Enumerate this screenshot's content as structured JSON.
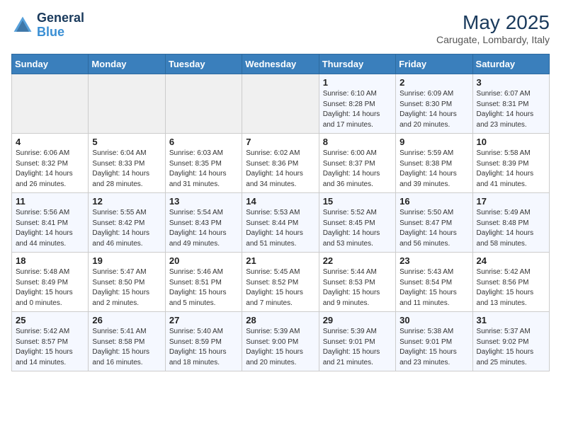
{
  "header": {
    "logo_line1": "General",
    "logo_line2": "Blue",
    "month": "May 2025",
    "location": "Carugate, Lombardy, Italy"
  },
  "weekdays": [
    "Sunday",
    "Monday",
    "Tuesday",
    "Wednesday",
    "Thursday",
    "Friday",
    "Saturday"
  ],
  "weeks": [
    [
      {
        "day": "",
        "info": ""
      },
      {
        "day": "",
        "info": ""
      },
      {
        "day": "",
        "info": ""
      },
      {
        "day": "",
        "info": ""
      },
      {
        "day": "1",
        "info": "Sunrise: 6:10 AM\nSunset: 8:28 PM\nDaylight: 14 hours\nand 17 minutes."
      },
      {
        "day": "2",
        "info": "Sunrise: 6:09 AM\nSunset: 8:30 PM\nDaylight: 14 hours\nand 20 minutes."
      },
      {
        "day": "3",
        "info": "Sunrise: 6:07 AM\nSunset: 8:31 PM\nDaylight: 14 hours\nand 23 minutes."
      }
    ],
    [
      {
        "day": "4",
        "info": "Sunrise: 6:06 AM\nSunset: 8:32 PM\nDaylight: 14 hours\nand 26 minutes."
      },
      {
        "day": "5",
        "info": "Sunrise: 6:04 AM\nSunset: 8:33 PM\nDaylight: 14 hours\nand 28 minutes."
      },
      {
        "day": "6",
        "info": "Sunrise: 6:03 AM\nSunset: 8:35 PM\nDaylight: 14 hours\nand 31 minutes."
      },
      {
        "day": "7",
        "info": "Sunrise: 6:02 AM\nSunset: 8:36 PM\nDaylight: 14 hours\nand 34 minutes."
      },
      {
        "day": "8",
        "info": "Sunrise: 6:00 AM\nSunset: 8:37 PM\nDaylight: 14 hours\nand 36 minutes."
      },
      {
        "day": "9",
        "info": "Sunrise: 5:59 AM\nSunset: 8:38 PM\nDaylight: 14 hours\nand 39 minutes."
      },
      {
        "day": "10",
        "info": "Sunrise: 5:58 AM\nSunset: 8:39 PM\nDaylight: 14 hours\nand 41 minutes."
      }
    ],
    [
      {
        "day": "11",
        "info": "Sunrise: 5:56 AM\nSunset: 8:41 PM\nDaylight: 14 hours\nand 44 minutes."
      },
      {
        "day": "12",
        "info": "Sunrise: 5:55 AM\nSunset: 8:42 PM\nDaylight: 14 hours\nand 46 minutes."
      },
      {
        "day": "13",
        "info": "Sunrise: 5:54 AM\nSunset: 8:43 PM\nDaylight: 14 hours\nand 49 minutes."
      },
      {
        "day": "14",
        "info": "Sunrise: 5:53 AM\nSunset: 8:44 PM\nDaylight: 14 hours\nand 51 minutes."
      },
      {
        "day": "15",
        "info": "Sunrise: 5:52 AM\nSunset: 8:45 PM\nDaylight: 14 hours\nand 53 minutes."
      },
      {
        "day": "16",
        "info": "Sunrise: 5:50 AM\nSunset: 8:47 PM\nDaylight: 14 hours\nand 56 minutes."
      },
      {
        "day": "17",
        "info": "Sunrise: 5:49 AM\nSunset: 8:48 PM\nDaylight: 14 hours\nand 58 minutes."
      }
    ],
    [
      {
        "day": "18",
        "info": "Sunrise: 5:48 AM\nSunset: 8:49 PM\nDaylight: 15 hours\nand 0 minutes."
      },
      {
        "day": "19",
        "info": "Sunrise: 5:47 AM\nSunset: 8:50 PM\nDaylight: 15 hours\nand 2 minutes."
      },
      {
        "day": "20",
        "info": "Sunrise: 5:46 AM\nSunset: 8:51 PM\nDaylight: 15 hours\nand 5 minutes."
      },
      {
        "day": "21",
        "info": "Sunrise: 5:45 AM\nSunset: 8:52 PM\nDaylight: 15 hours\nand 7 minutes."
      },
      {
        "day": "22",
        "info": "Sunrise: 5:44 AM\nSunset: 8:53 PM\nDaylight: 15 hours\nand 9 minutes."
      },
      {
        "day": "23",
        "info": "Sunrise: 5:43 AM\nSunset: 8:54 PM\nDaylight: 15 hours\nand 11 minutes."
      },
      {
        "day": "24",
        "info": "Sunrise: 5:42 AM\nSunset: 8:56 PM\nDaylight: 15 hours\nand 13 minutes."
      }
    ],
    [
      {
        "day": "25",
        "info": "Sunrise: 5:42 AM\nSunset: 8:57 PM\nDaylight: 15 hours\nand 14 minutes."
      },
      {
        "day": "26",
        "info": "Sunrise: 5:41 AM\nSunset: 8:58 PM\nDaylight: 15 hours\nand 16 minutes."
      },
      {
        "day": "27",
        "info": "Sunrise: 5:40 AM\nSunset: 8:59 PM\nDaylight: 15 hours\nand 18 minutes."
      },
      {
        "day": "28",
        "info": "Sunrise: 5:39 AM\nSunset: 9:00 PM\nDaylight: 15 hours\nand 20 minutes."
      },
      {
        "day": "29",
        "info": "Sunrise: 5:39 AM\nSunset: 9:01 PM\nDaylight: 15 hours\nand 21 minutes."
      },
      {
        "day": "30",
        "info": "Sunrise: 5:38 AM\nSunset: 9:01 PM\nDaylight: 15 hours\nand 23 minutes."
      },
      {
        "day": "31",
        "info": "Sunrise: 5:37 AM\nSunset: 9:02 PM\nDaylight: 15 hours\nand 25 minutes."
      }
    ]
  ]
}
